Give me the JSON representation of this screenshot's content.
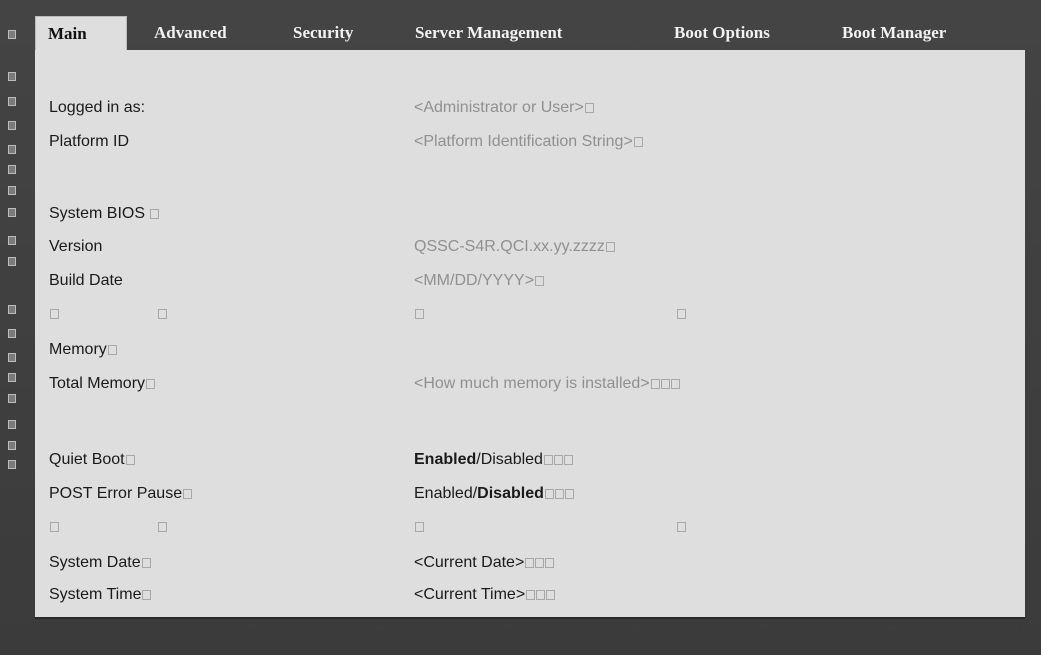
{
  "tabs": [
    {
      "label": "Main",
      "active": true
    },
    {
      "label": "Advanced",
      "active": false
    },
    {
      "label": "Security",
      "active": false
    },
    {
      "label": "Server Management",
      "active": false
    },
    {
      "label": "Boot Options",
      "active": false
    },
    {
      "label": "Boot Manager",
      "active": false
    }
  ],
  "main": {
    "logged_in": {
      "label": "Logged in as:",
      "value": "<Administrator or User>"
    },
    "platform_id": {
      "label": "Platform ID",
      "value": "<Platform Identification String>"
    },
    "system_bios": {
      "label": "System BIOS"
    },
    "version": {
      "label": "Version",
      "value": "QSSC-S4R.QCI.xx.yy.zzzz"
    },
    "build_date": {
      "label": "Build Date",
      "value": "<MM/DD/YYYY>"
    },
    "memory": {
      "label": "Memory"
    },
    "total_memory": {
      "label": "Total Memory",
      "value": "<How much memory is installed>"
    },
    "quiet_boot": {
      "label": "Quiet Boot",
      "value_a": "Enabled",
      "sep": "/",
      "value_b": "Disabled"
    },
    "post_error_pause": {
      "label": "POST Error Pause",
      "value_a": "Enabled",
      "sep": "/",
      "value_b": "Disabled"
    },
    "system_date": {
      "label": "System Date",
      "value": "<Current Date>"
    },
    "system_time": {
      "label": "System Time",
      "value": "<Current Time>"
    }
  },
  "colors": {
    "panel": "#dedede",
    "background": "#3a3a3a",
    "muted_value": "#909090",
    "text": "#1a1a1a"
  }
}
